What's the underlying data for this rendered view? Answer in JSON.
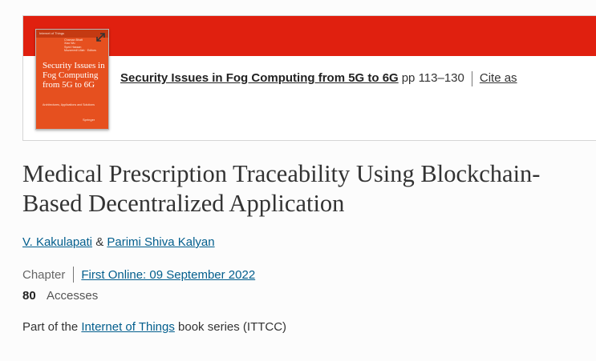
{
  "book": {
    "cover": {
      "series": "Internet of Things",
      "authors": [
        "Chaman Bhatt",
        "Xiao Wu",
        "Syed Hassan",
        "Muzammil Ullah · Editors"
      ],
      "title": "Security Issues in Fog Computing from 5G to 6G",
      "subtitle": "Architectures, Applications and Solutions",
      "publisher": "Springer",
      "expand_icon": "expand-arrows-icon"
    },
    "title": "Security Issues in Fog Computing from 5G to 6G",
    "pages": "pp 113–130",
    "cite_label": "Cite as"
  },
  "article": {
    "title": "Medical Prescription Traceability Using Blockchain-Based Decentralized Application",
    "authors": [
      "V. Kakulapati",
      "Parimi Shiva Kalyan"
    ],
    "author_separator": "&",
    "type": "Chapter",
    "first_online": "First Online: 09 September 2022",
    "accesses_count": "80",
    "accesses_label": "Accesses",
    "series_prefix": "Part of the",
    "series_name": "Internet of Things",
    "series_suffix": "book series (ITTCC)"
  },
  "colors": {
    "brand_red": "#e0200f",
    "link_blue": "#025e8d",
    "cover_orange": "#e6501f"
  }
}
